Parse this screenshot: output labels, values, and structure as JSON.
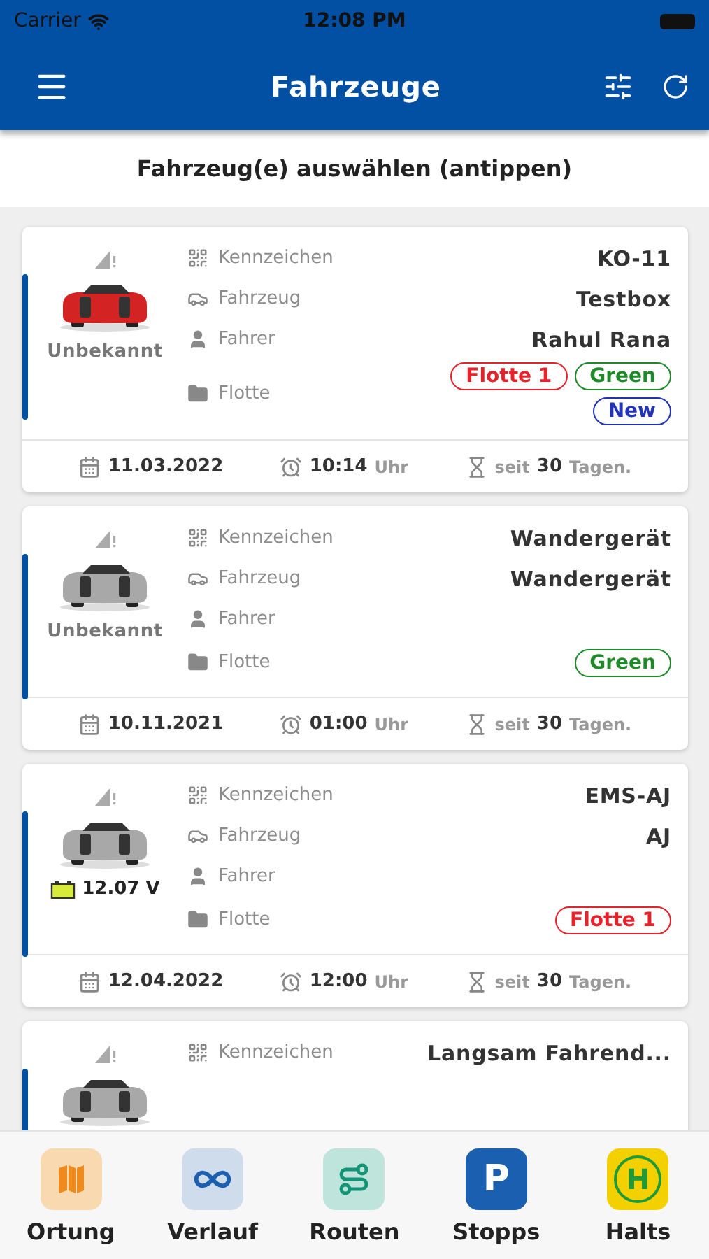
{
  "status_bar": {
    "carrier": "Carrier",
    "time": "12:08 PM"
  },
  "header": {
    "title": "Fahrzeuge"
  },
  "subtitle": "Fahrzeug(e) auswählen (antippen)",
  "vehicles": [
    {
      "color": "#d42323",
      "status": {
        "kind": "text",
        "text": "Unbekannt"
      },
      "rows": [
        {
          "kind": "plate",
          "label": "Kennzeichen",
          "value": "KO-11"
        },
        {
          "kind": "vehicle",
          "label": "Fahrzeug",
          "value": "Testbox"
        },
        {
          "kind": "driver",
          "label": "Fahrer",
          "value": "Rahul Rana"
        },
        {
          "kind": "fleet",
          "label": "Flotte",
          "tags": [
            {
              "text": "Flotte 1",
              "color": "#e8222a"
            },
            {
              "text": "Green",
              "color": "#1f8a2a"
            },
            {
              "text": "New",
              "color": "#2233b8"
            }
          ]
        }
      ],
      "footer": {
        "date": "11.03.2022",
        "time": "10:14",
        "time_unit": "Uhr",
        "since_prefix": "seit",
        "since_days": "30",
        "since_suffix": "Tagen."
      }
    },
    {
      "color": "#a8a8a8",
      "status": {
        "kind": "text",
        "text": "Unbekannt"
      },
      "rows": [
        {
          "kind": "plate",
          "label": "Kennzeichen",
          "value": "Wandergerät"
        },
        {
          "kind": "vehicle",
          "label": "Fahrzeug",
          "value": "Wandergerät"
        },
        {
          "kind": "driver",
          "label": "Fahrer"
        },
        {
          "kind": "fleet",
          "label": "Flotte",
          "tags": [
            {
              "text": "Green",
              "color": "#1f8a2a"
            }
          ]
        }
      ],
      "footer": {
        "date": "10.11.2021",
        "time": "01:00",
        "time_unit": "Uhr",
        "since_prefix": "seit",
        "since_days": "30",
        "since_suffix": "Tagen."
      }
    },
    {
      "color": "#a8a8a8",
      "status": {
        "kind": "battery",
        "text": "12.07 V"
      },
      "rows": [
        {
          "kind": "plate",
          "label": "Kennzeichen",
          "value": "EMS-AJ"
        },
        {
          "kind": "vehicle",
          "label": "Fahrzeug",
          "value": "AJ"
        },
        {
          "kind": "driver",
          "label": "Fahrer"
        },
        {
          "kind": "fleet",
          "label": "Flotte",
          "tags": [
            {
              "text": "Flotte 1",
              "color": "#e8222a"
            }
          ]
        }
      ],
      "footer": {
        "date": "12.04.2022",
        "time": "12:00",
        "time_unit": "Uhr",
        "since_prefix": "seit",
        "since_days": "30",
        "since_suffix": "Tagen."
      }
    },
    {
      "color": "#a8a8a8",
      "rows": [
        {
          "kind": "plate",
          "label": "Kennzeichen",
          "value": "Langsam Fahrend..."
        }
      ]
    }
  ],
  "bottom_nav": [
    {
      "kind": "map",
      "label": "Ortung"
    },
    {
      "kind": "infinity",
      "label": "Verlauf"
    },
    {
      "kind": "route",
      "label": "Routen"
    },
    {
      "kind": "parking",
      "label": "Stopps",
      "glyph": "P"
    },
    {
      "kind": "stop",
      "label": "Halts",
      "glyph": "H"
    }
  ]
}
